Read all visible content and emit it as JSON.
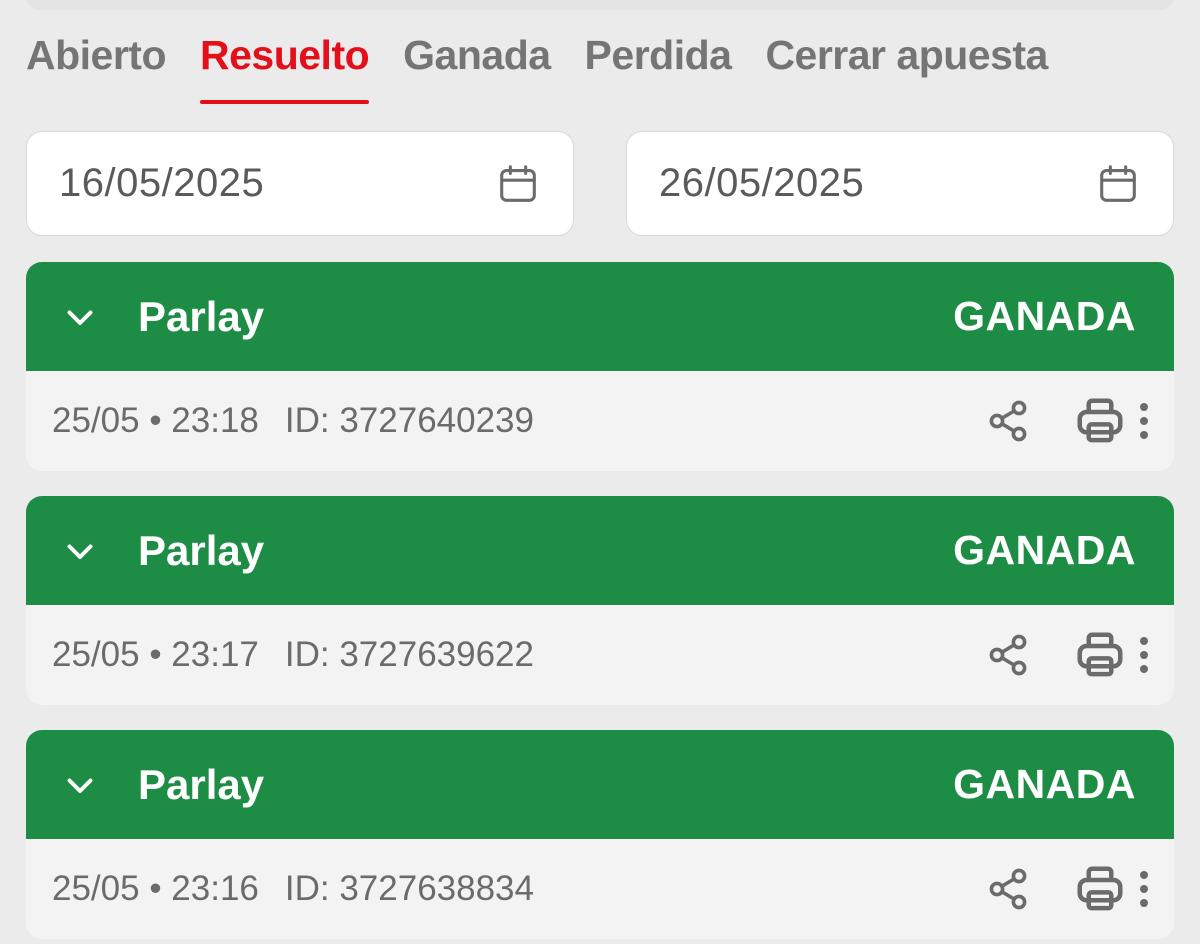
{
  "tabs": [
    {
      "label": "Abierto",
      "active": false
    },
    {
      "label": "Resuelto",
      "active": true
    },
    {
      "label": "Ganada",
      "active": false
    },
    {
      "label": "Perdida",
      "active": false
    },
    {
      "label": "Cerrar apuesta",
      "active": false
    }
  ],
  "date_range": {
    "from": "16/05/2025",
    "to": "26/05/2025",
    "icon": "calendar-icon"
  },
  "colors": {
    "accent": "#e3101b",
    "won_header": "#1d8d45",
    "tab_inactive": "#757575"
  },
  "bets": [
    {
      "type": "Parlay",
      "status": "GANADA",
      "date": "25/05",
      "time": "23:18",
      "id": "ID: 3727640239"
    },
    {
      "type": "Parlay",
      "status": "GANADA",
      "date": "25/05",
      "time": "23:17",
      "id": "ID: 3727639622"
    },
    {
      "type": "Parlay",
      "status": "GANADA",
      "date": "25/05",
      "time": "23:16",
      "id": "ID: 3727638834"
    }
  ],
  "icons": {
    "expand": "chevron-down-icon",
    "share": "share-icon",
    "print": "print-icon",
    "more": "more-vertical-icon"
  }
}
